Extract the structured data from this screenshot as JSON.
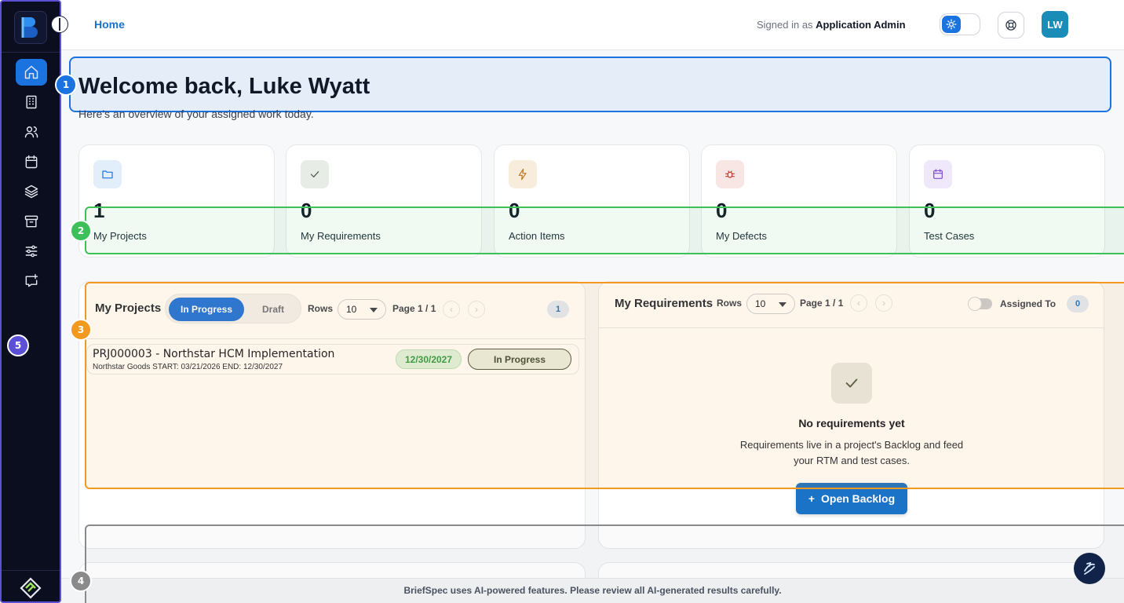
{
  "header": {
    "home_link": "Home",
    "signed_in_prefix": "Signed in as ",
    "signed_in_user": "Application Admin",
    "avatar_initials": "LW"
  },
  "annotations": [
    "1",
    "2",
    "3",
    "4",
    "5"
  ],
  "welcome": {
    "title": "Welcome back, Luke Wyatt",
    "subtitle": "Here's an overview of your assigned work today."
  },
  "stats": [
    {
      "value": "1",
      "label": "My Projects",
      "icon": "folder-icon",
      "color": "#1b73e0",
      "bg": "#e3eefb"
    },
    {
      "value": "0",
      "label": "My Requirements",
      "icon": "check-icon",
      "color": "#4b5a45",
      "bg": "#e7ece6"
    },
    {
      "value": "0",
      "label": "Action Items",
      "icon": "lightning-icon",
      "color": "#b7791f",
      "bg": "#f8eddc"
    },
    {
      "value": "0",
      "label": "My Defects",
      "icon": "bug-icon",
      "color": "#c0392b",
      "bg": "#f8e6e4"
    },
    {
      "value": "0",
      "label": "Test Cases",
      "icon": "calendar-icon",
      "color": "#7c4dcc",
      "bg": "#efe8fa"
    }
  ],
  "projects_panel": {
    "title": "My Projects",
    "tabs": [
      "In Progress",
      "Draft"
    ],
    "rows_label": "Rows",
    "rows_value": "10",
    "page_text": "Page 1 / 1",
    "count": "1",
    "rows": [
      {
        "name": "PRJ000003 - Northstar HCM Implementation",
        "client": "Northstar Goods",
        "dates": "START: 03/21/2026 END: 12/30/2027",
        "due": "12/30/2027",
        "status": "In Progress"
      }
    ]
  },
  "requirements_panel": {
    "title": "My Requirements",
    "rows_label": "Rows",
    "rows_value": "10",
    "page_text": "Page 1 / 1",
    "assigned_label": "Assigned To",
    "count": "0",
    "empty_title": "No requirements yet",
    "empty_desc": "Requirements live in a project's Backlog and feed your RTM and test cases.",
    "button_label": "Open Backlog"
  },
  "footer": {
    "text": "BriefSpec uses AI-powered features. Please review all AI-generated results carefully."
  },
  "colors": {
    "sidebar_bg": "#0b0e1f",
    "accent": "#1b73e0",
    "badge_1": "#1b73e0",
    "badge_2": "#3cc15a",
    "badge_3": "#f29a1f",
    "badge_4": "#8a8a8a",
    "badge_5": "#5b4fd6"
  }
}
